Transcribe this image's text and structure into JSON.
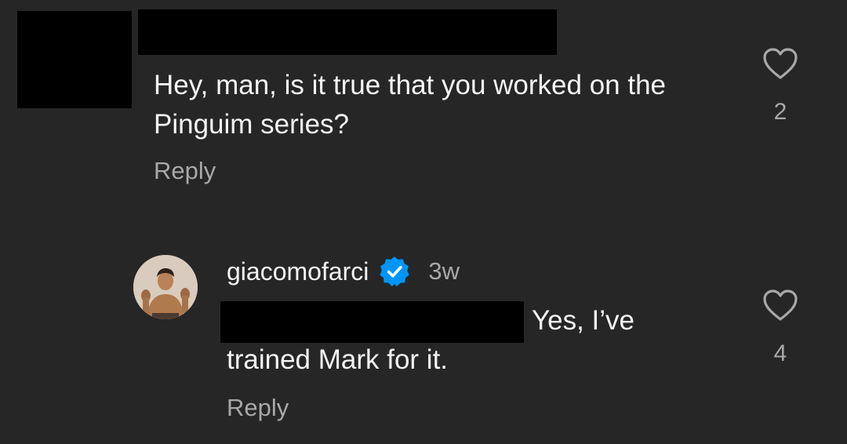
{
  "comment1": {
    "text": "Hey, man, is it true that you worked on the Pinguim series?",
    "reply_label": "Reply",
    "like_count": "2",
    "like_icon": "heart-outline-icon"
  },
  "comment2": {
    "username": "giacomofarci",
    "verified_icon": "verified-badge-icon",
    "time": "3w",
    "text_line1": "Yes, I’ve",
    "text_line2": "trained Mark for it.",
    "reply_label": "Reply",
    "like_count": "4",
    "like_icon": "heart-outline-icon"
  },
  "colors": {
    "background": "#262626",
    "primary_text": "#f5f5f5",
    "secondary_text": "#a8a8a8",
    "verified_blue": "#0095f6",
    "redaction": "#000000"
  }
}
